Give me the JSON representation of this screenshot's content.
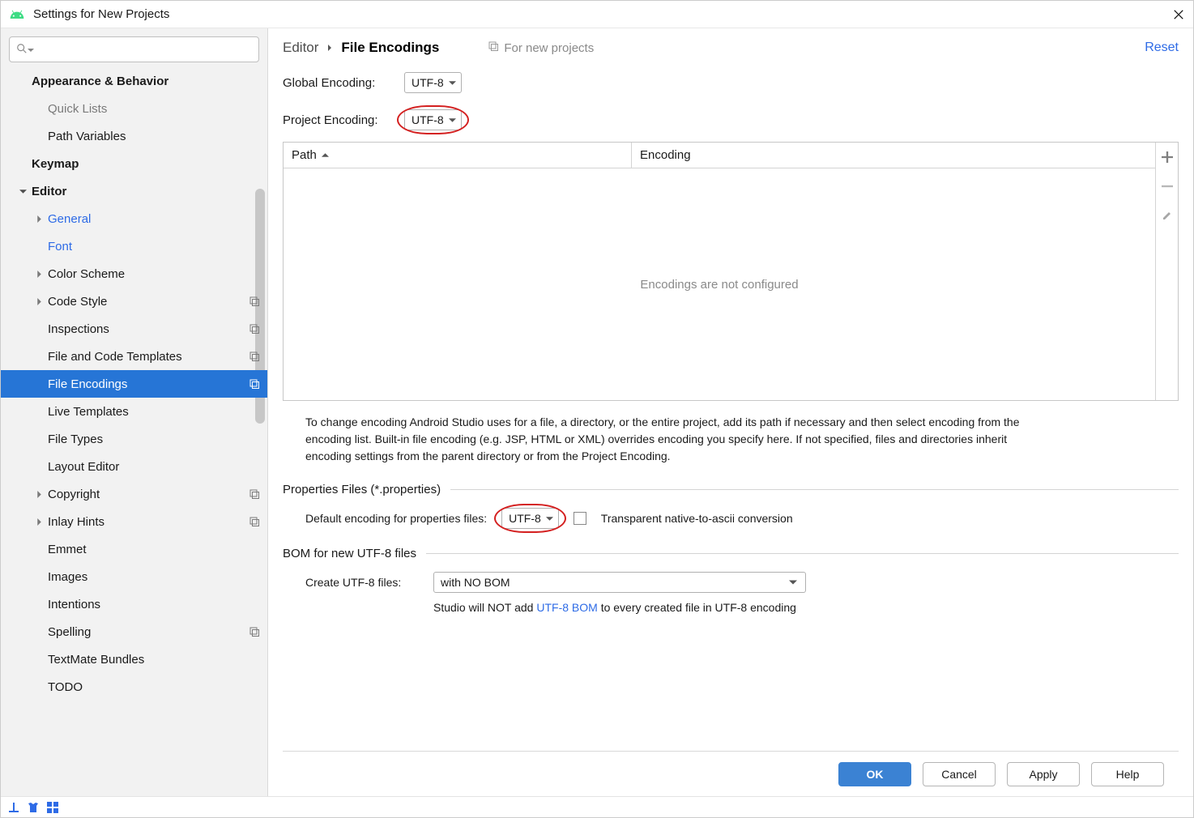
{
  "window": {
    "title": "Settings for New Projects"
  },
  "sidebar": {
    "search_placeholder": "",
    "items": [
      {
        "label": "Appearance & Behavior",
        "depth": 1,
        "bold": true
      },
      {
        "label": "Quick Lists",
        "depth": 2,
        "cut": true
      },
      {
        "label": "Path Variables",
        "depth": 2
      },
      {
        "label": "Keymap",
        "depth": 1,
        "bold": true
      },
      {
        "label": "Editor",
        "depth": 1,
        "bold": true,
        "expanded": true
      },
      {
        "label": "General",
        "depth": 2,
        "blue": true,
        "chev": true
      },
      {
        "label": "Font",
        "depth": 2,
        "blue": true
      },
      {
        "label": "Color Scheme",
        "depth": 2,
        "chev": true
      },
      {
        "label": "Code Style",
        "depth": 2,
        "chev": true,
        "tag": true
      },
      {
        "label": "Inspections",
        "depth": 2,
        "tag": true
      },
      {
        "label": "File and Code Templates",
        "depth": 2,
        "tag": true
      },
      {
        "label": "File Encodings",
        "depth": 2,
        "tag": true,
        "selected": true
      },
      {
        "label": "Live Templates",
        "depth": 2
      },
      {
        "label": "File Types",
        "depth": 2
      },
      {
        "label": "Layout Editor",
        "depth": 2
      },
      {
        "label": "Copyright",
        "depth": 2,
        "chev": true,
        "tag": true
      },
      {
        "label": "Inlay Hints",
        "depth": 2,
        "chev": true,
        "tag": true
      },
      {
        "label": "Emmet",
        "depth": 2
      },
      {
        "label": "Images",
        "depth": 2
      },
      {
        "label": "Intentions",
        "depth": 2
      },
      {
        "label": "Spelling",
        "depth": 2,
        "tag": true
      },
      {
        "label": "TextMate Bundles",
        "depth": 2
      },
      {
        "label": "TODO",
        "depth": 2
      }
    ]
  },
  "breadcrumb": {
    "a": "Editor",
    "b": "File Encodings"
  },
  "new_projects_hint": "For new projects",
  "reset": "Reset",
  "global_encoding": {
    "label": "Global Encoding:",
    "value": "UTF-8"
  },
  "project_encoding": {
    "label": "Project Encoding:",
    "value": "UTF-8"
  },
  "table": {
    "col_path": "Path",
    "col_enc": "Encoding",
    "empty": "Encodings are not configured"
  },
  "description": "To change encoding Android Studio uses for a file, a directory, or the entire project, add its path if necessary and then select encoding from the encoding list. Built-in file encoding (e.g. JSP, HTML or XML) overrides encoding you specify here. If not specified, files and directories inherit encoding settings from the parent directory or from the Project Encoding.",
  "properties": {
    "section": "Properties Files (*.properties)",
    "label": "Default encoding for properties files:",
    "value": "UTF-8",
    "checkbox_label": "Transparent native-to-ascii conversion"
  },
  "bom": {
    "section": "BOM for new UTF-8 files",
    "label": "Create UTF-8 files:",
    "value": "with NO BOM",
    "help_prefix": "Studio will NOT add ",
    "help_link": "UTF-8 BOM",
    "help_suffix": " to every created file in UTF-8 encoding"
  },
  "buttons": {
    "ok": "OK",
    "cancel": "Cancel",
    "apply": "Apply",
    "help": "Help"
  }
}
